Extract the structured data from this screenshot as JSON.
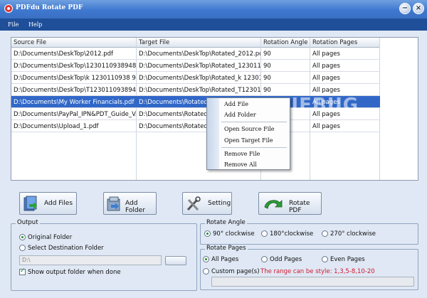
{
  "window": {
    "title": "PDFdu Rotate PDF",
    "min_glyph": "−",
    "close_glyph": "×"
  },
  "menu": {
    "file": "File",
    "help": "Help"
  },
  "table": {
    "headers": [
      "Source File",
      "Target File",
      "Rotation Angle",
      "Rotation Pages"
    ],
    "rows": [
      [
        "D:\\Documents\\DeskTop\\2012.pdf",
        "D:\\Documents\\DeskTop\\Rotated_2012.pdf",
        "90",
        "All pages"
      ],
      [
        "D:\\Documents\\DeskTop\\1230110938948...",
        "D:\\Documents\\DeskTop\\Rotated_123011...",
        "90",
        "All pages"
      ],
      [
        "D:\\Documents\\DeskTop\\k 1230110938 94...",
        "D:\\Documents\\DeskTop\\Rotated_k 12301...",
        "90",
        "All pages"
      ],
      [
        "D:\\Documents\\DeskTop\\T1230110938948...",
        "D:\\Documents\\DeskTop\\Rotated_T12301...",
        "90",
        "All pages"
      ],
      [
        "D:\\Documents\\My Worker Financials.pdf",
        "D:\\Documents\\Rotated_My Worker Financi...",
        "90",
        "All pages"
      ],
      [
        "D:\\Documents\\PayPal_IPN&PDT_Guide_V...",
        "D:\\Documents\\Rotated_P",
        "",
        "All pages"
      ],
      [
        "D:\\Documents\\Upload_1.pdf",
        "D:\\Documents\\Rotated_U",
        "",
        "All pages"
      ]
    ],
    "selected_row": 4
  },
  "context_menu": {
    "add_file": "Add File",
    "add_folder": "Add Folder",
    "open_source": "Open Source File",
    "open_target": "Open Target File",
    "remove_file": "Remove File",
    "remove_all": "Remove All"
  },
  "watermark": "UEBUG",
  "actions": {
    "add_files": "Add Files",
    "add_folder": "Add Folder",
    "setting": "Setting",
    "rotate": "Rotate PDF"
  },
  "output": {
    "legend": "Output",
    "original": "Original Folder",
    "destination": "Select Destination Folder",
    "path_value": "D:\\",
    "show_when_done": "Show output folder when done",
    "original_selected": true,
    "show_checked": true
  },
  "rotate_angle": {
    "legend": "Rotate Angle",
    "opt90": "90° clockwise",
    "opt180": "180°clockwise",
    "opt270": "270° clockwise",
    "selected": "90"
  },
  "rotate_pages": {
    "legend": "Rotate Pages",
    "all": "All Pages",
    "odd": "Odd Pages",
    "even": "Even Pages",
    "custom": "Custom page(s)",
    "hint": "The range can be style:  1,3,5-8,10-20",
    "selected": "all"
  },
  "colors": {
    "selection": "#3168c8",
    "titlebar": "#3f78cf",
    "menubar": "#1f4f99",
    "hint": "#d0192f"
  }
}
